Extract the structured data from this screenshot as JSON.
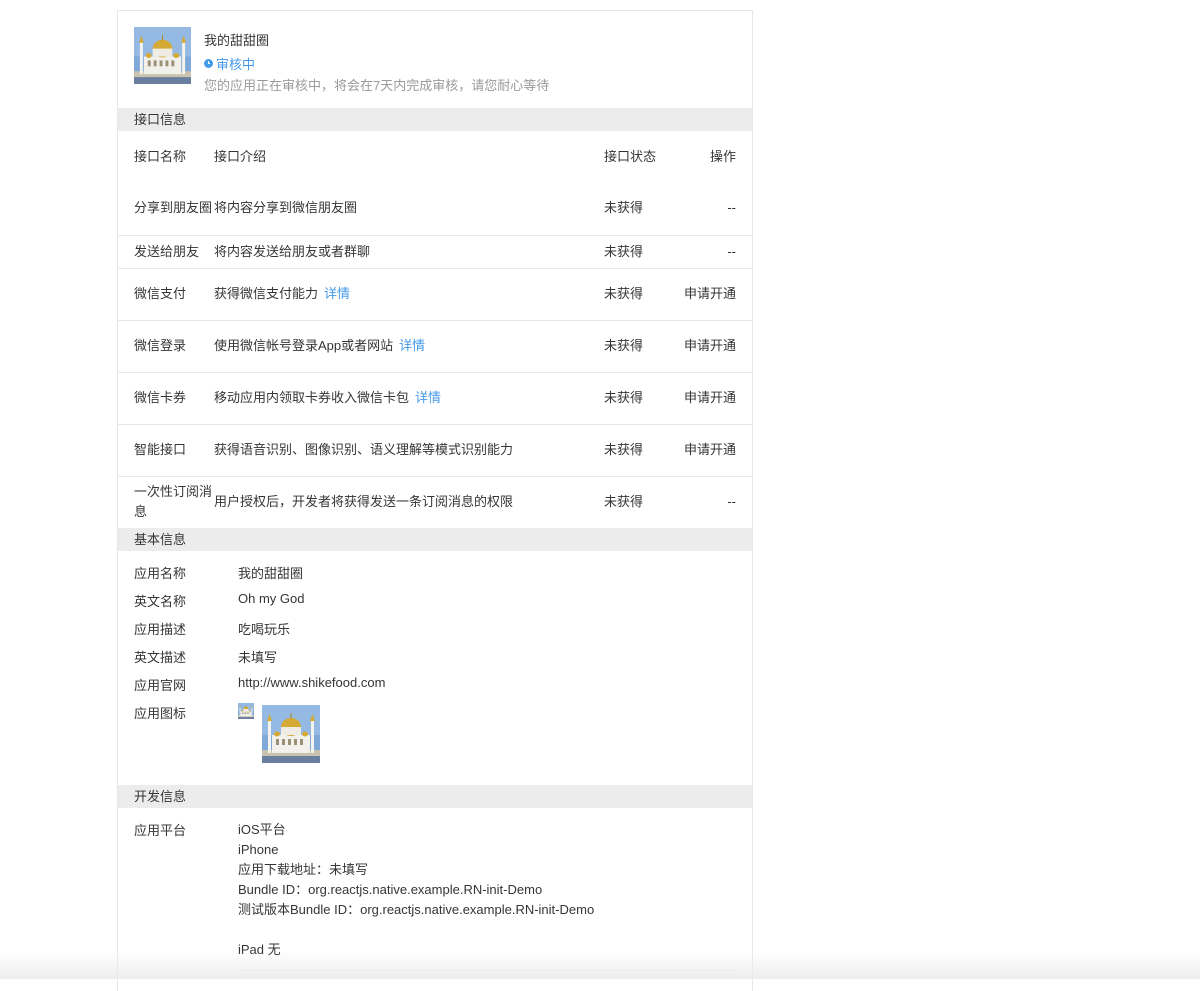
{
  "app": {
    "name": "我的甜甜圈",
    "status": "审核中",
    "status_note": "您的应用正在审核中，将会在7天内完成审核，请您耐心等待"
  },
  "api_section": {
    "title": "接口信息",
    "headers": [
      "接口名称",
      "接口介绍",
      "接口状态",
      "操作"
    ],
    "rows": [
      {
        "name": "分享到朋友圈",
        "desc": "将内容分享到微信朋友圈",
        "detail": "",
        "status": "未获得",
        "action": "--",
        "action_link": false
      },
      {
        "name": "发送给朋友",
        "desc": "将内容发送给朋友或者群聊",
        "detail": "",
        "status": "未获得",
        "action": "--",
        "action_link": false
      },
      {
        "name": "微信支付",
        "desc": "获得微信支付能力",
        "detail": "详情",
        "status": "未获得",
        "action": "申请开通",
        "action_link": true
      },
      {
        "name": "微信登录",
        "desc": "使用微信帐号登录App或者网站",
        "detail": "详情",
        "status": "未获得",
        "action": "申请开通",
        "action_link": true
      },
      {
        "name": "微信卡券",
        "desc": "移动应用内领取卡券收入微信卡包",
        "detail": "详情",
        "status": "未获得",
        "action": "申请开通",
        "action_link": true
      },
      {
        "name": "智能接口",
        "desc": "获得语音识别、图像识别、语义理解等模式识别能力",
        "detail": "",
        "status": "未获得",
        "action": "申请开通",
        "action_link": true
      },
      {
        "name": "一次性订阅消息",
        "desc": "用户授权后，开发者将获得发送一条订阅消息的权限",
        "detail": "",
        "status": "未获得",
        "action": "--",
        "action_link": false
      }
    ]
  },
  "basic_section": {
    "title": "基本信息",
    "rows": [
      {
        "label": "应用名称",
        "value": "我的甜甜圈"
      },
      {
        "label": "英文名称",
        "value": "Oh my God"
      },
      {
        "label": "应用描述",
        "value": "吃喝玩乐"
      },
      {
        "label": "英文描述",
        "value": "未填写"
      },
      {
        "label": "应用官网",
        "value": "http://www.shikefood.com"
      }
    ],
    "icon_label": "应用图标"
  },
  "dev_section": {
    "title": "开发信息",
    "platform_label": "应用平台",
    "lines": [
      "iOS平台",
      "iPhone",
      "应用下载地址：未填写",
      "Bundle ID：org.reactjs.native.example.RN-init-Demo",
      "测试版本Bundle ID：org.reactjs.native.example.RN-init-Demo"
    ],
    "ipad_line": "iPad 无"
  },
  "icons": {
    "status": "clock-icon",
    "app_image": "mosque-image"
  },
  "colors": {
    "accent": "#459ae9",
    "section_bg": "#ececec",
    "border": "#e7e7eb",
    "muted": "#9a9a9a"
  }
}
